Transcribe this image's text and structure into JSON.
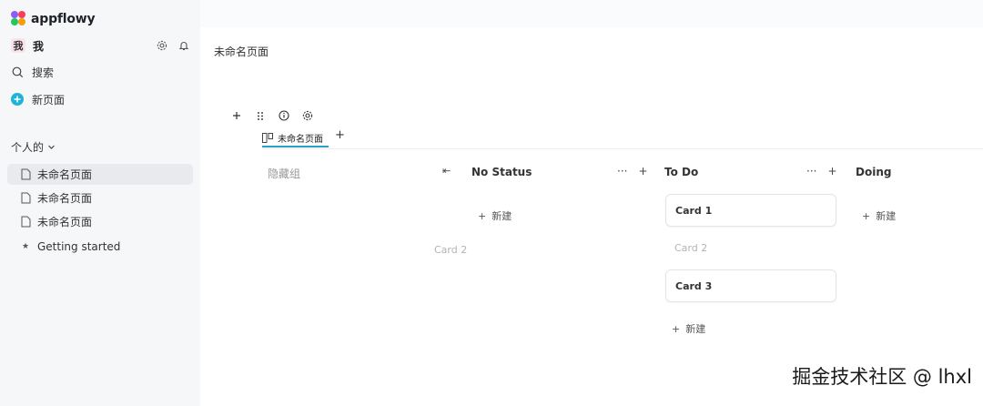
{
  "brand": {
    "name": "appflowy"
  },
  "user": {
    "avatar": "我",
    "name": "我"
  },
  "sidebar": {
    "search_label": "搜索",
    "new_page_label": "新页面",
    "section_label": "个人的",
    "pages": [
      {
        "label": "未命名页面",
        "icon": "page-icon",
        "active": true
      },
      {
        "label": "未命名页面",
        "icon": "page-icon"
      },
      {
        "label": "未命名页面",
        "icon": "page-icon"
      },
      {
        "label": "Getting started",
        "icon": "star-icon"
      }
    ]
  },
  "main": {
    "page_title": "未命名页面",
    "view_tab_label": "未命名页面",
    "hidden_group_label": "隐藏组"
  },
  "board": {
    "columns": [
      {
        "title": "No Status",
        "new_label": "新建"
      },
      {
        "title": "To Do",
        "new_label": "新建"
      },
      {
        "title": "Doing",
        "new_label": "新建"
      }
    ],
    "cards": {
      "dragging": "Card 2",
      "todo": [
        "Card 1",
        "Card 2",
        "Card 3"
      ]
    },
    "actions": {
      "more": "···",
      "add": "+"
    }
  },
  "watermark": "掘金技术社区 @ lhxl",
  "colors": {
    "accent": "#27a3c9",
    "sidebar_bg": "#f6f7f9",
    "active_row": "#e8eaed",
    "new_page_icon": "#20b3d6"
  }
}
